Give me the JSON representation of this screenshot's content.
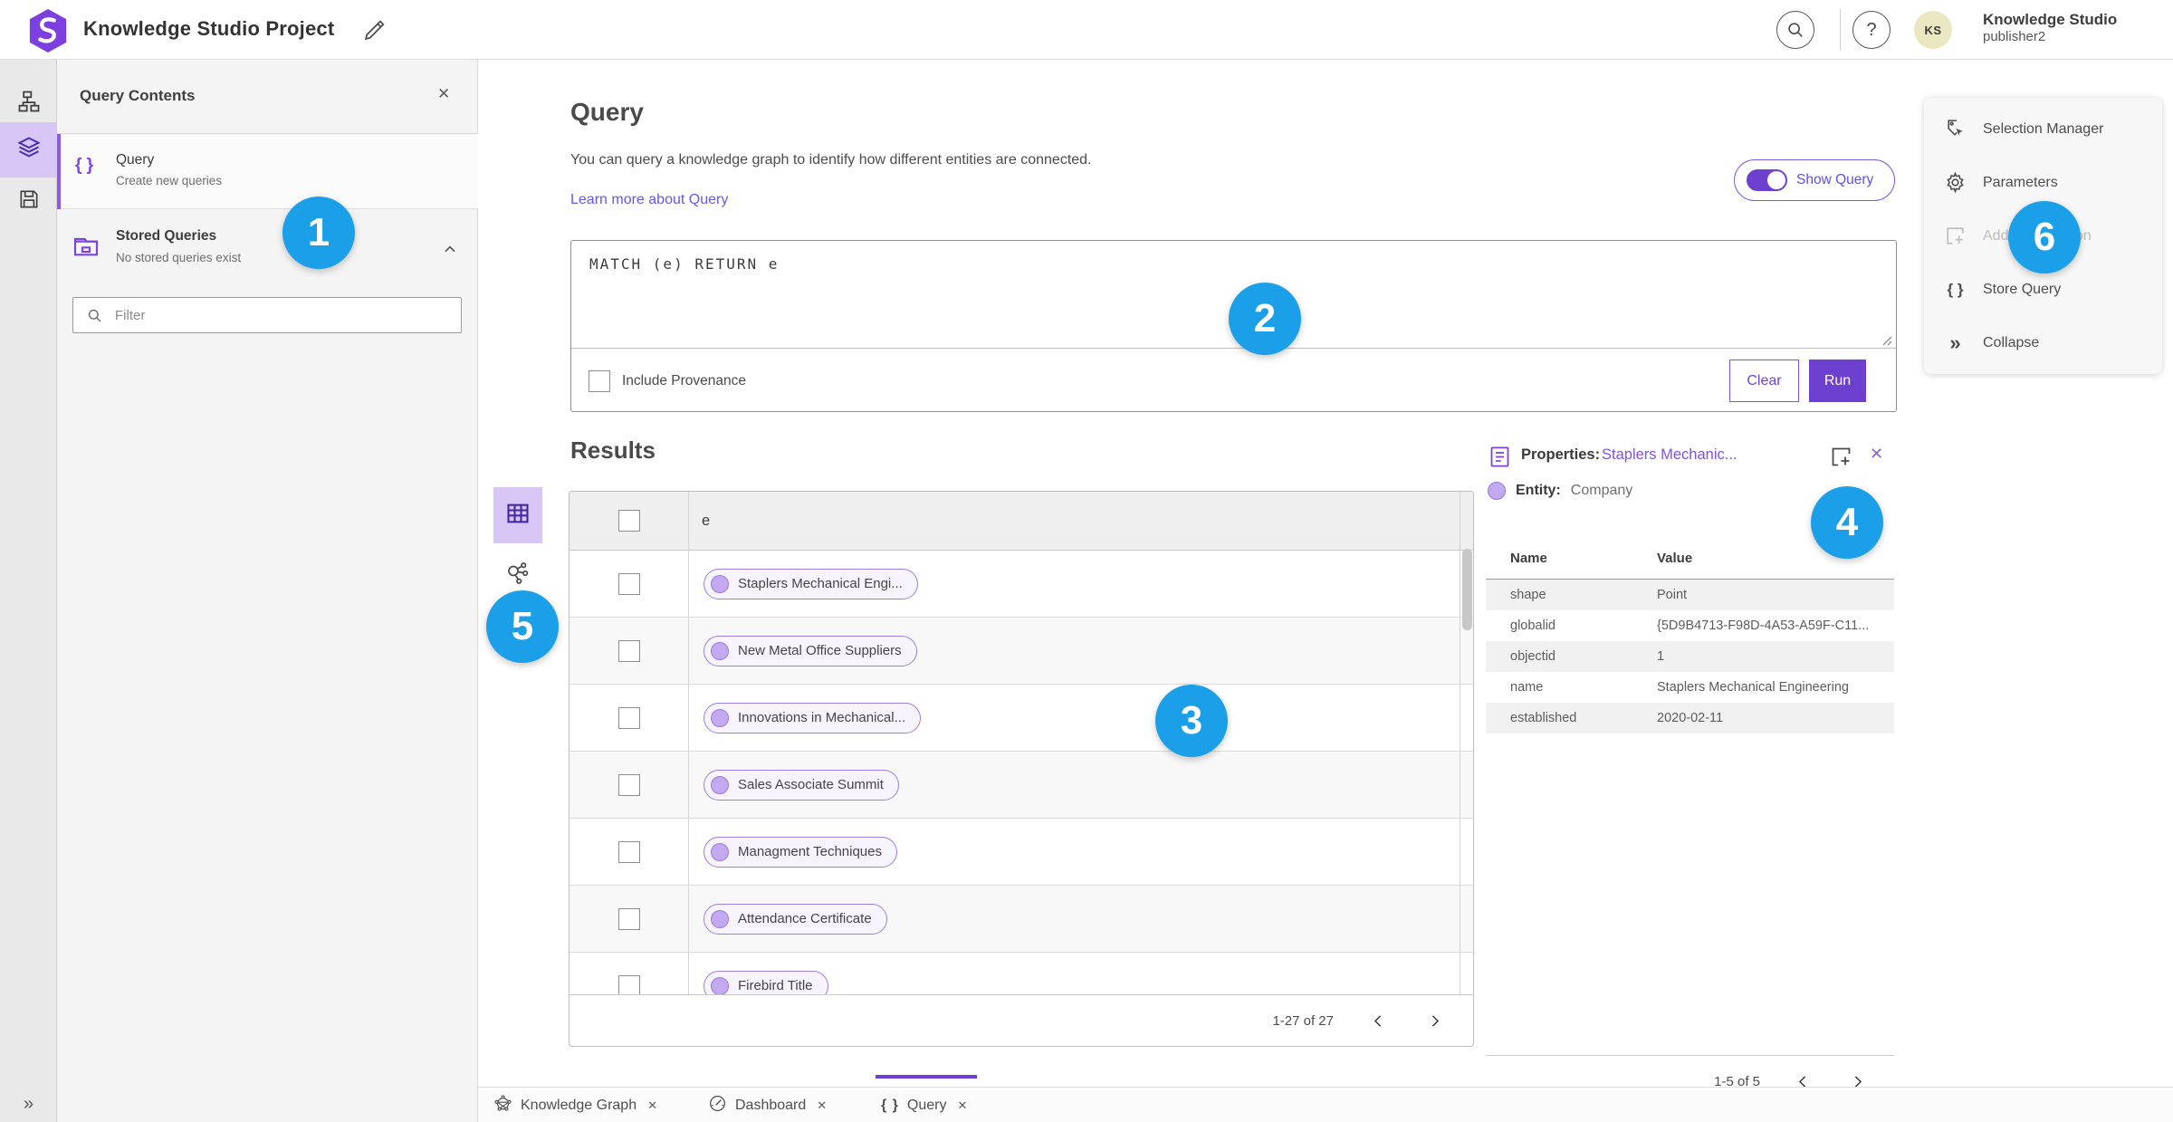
{
  "header": {
    "title": "Knowledge Studio Project",
    "user_name": "Knowledge Studio",
    "user_role": "publisher2",
    "avatar_initials": "KS",
    "help_glyph": "?"
  },
  "contents_panel": {
    "title": "Query Contents",
    "close_glyph": "✕",
    "query_item": {
      "label": "Query",
      "sublabel": "Create new queries",
      "icon_glyph": "{ }"
    },
    "stored_item": {
      "label": "Stored Queries",
      "sublabel": "No stored queries exist"
    },
    "filter_placeholder": "Filter"
  },
  "query_section": {
    "title": "Query",
    "description": "You can query a knowledge graph to identify how different entities are connected.",
    "learn_more": "Learn more about Query",
    "show_query_label": "Show Query",
    "query_text": "MATCH (e) RETURN e",
    "include_provenance_label": "Include Provenance",
    "clear_label": "Clear",
    "run_label": "Run"
  },
  "results": {
    "title": "Results",
    "column_header": "e",
    "rows": [
      "Staplers Mechanical Engi...",
      "New Metal Office Suppliers",
      "Innovations in Mechanical...",
      "Sales Associate Summit",
      "Managment Techniques",
      "Attendance Certificate",
      "Firebird Title"
    ],
    "pagination": "1-27 of 27"
  },
  "properties_panel": {
    "title": "Properties:",
    "entity_link": "Staplers Mechanic...",
    "entity_label": "Entity:",
    "entity_type": "Company",
    "close_glyph": "✕",
    "columns": {
      "name": "Name",
      "value": "Value"
    },
    "rows": [
      {
        "name": "shape",
        "value": "Point"
      },
      {
        "name": "globalid",
        "value": "{5D9B4713-F98D-4A53-A59F-C11..."
      },
      {
        "name": "objectid",
        "value": "1"
      },
      {
        "name": "name",
        "value": "Staplers Mechanical Engineering"
      },
      {
        "name": "established",
        "value": "2020-02-11"
      }
    ],
    "pagination": "1-5 of 5"
  },
  "side_menu": {
    "items": [
      "Selection Manager",
      "Parameters",
      "Add To Selection",
      "Store Query",
      "Collapse"
    ],
    "store_query_glyph": "{ }",
    "collapse_glyph": "»"
  },
  "tabs": [
    {
      "label": "Knowledge Graph"
    },
    {
      "label": "Dashboard"
    },
    {
      "label": "Query",
      "active": true
    }
  ],
  "tab_close_glyph": "✕",
  "rail_expand_glyph": "»",
  "badges": [
    "1",
    "2",
    "3",
    "4",
    "5",
    "6"
  ],
  "colors": {
    "accent_purple": "#6d40d0",
    "badge_blue": "#1b9fe8",
    "link_purple": "#6658e8"
  }
}
